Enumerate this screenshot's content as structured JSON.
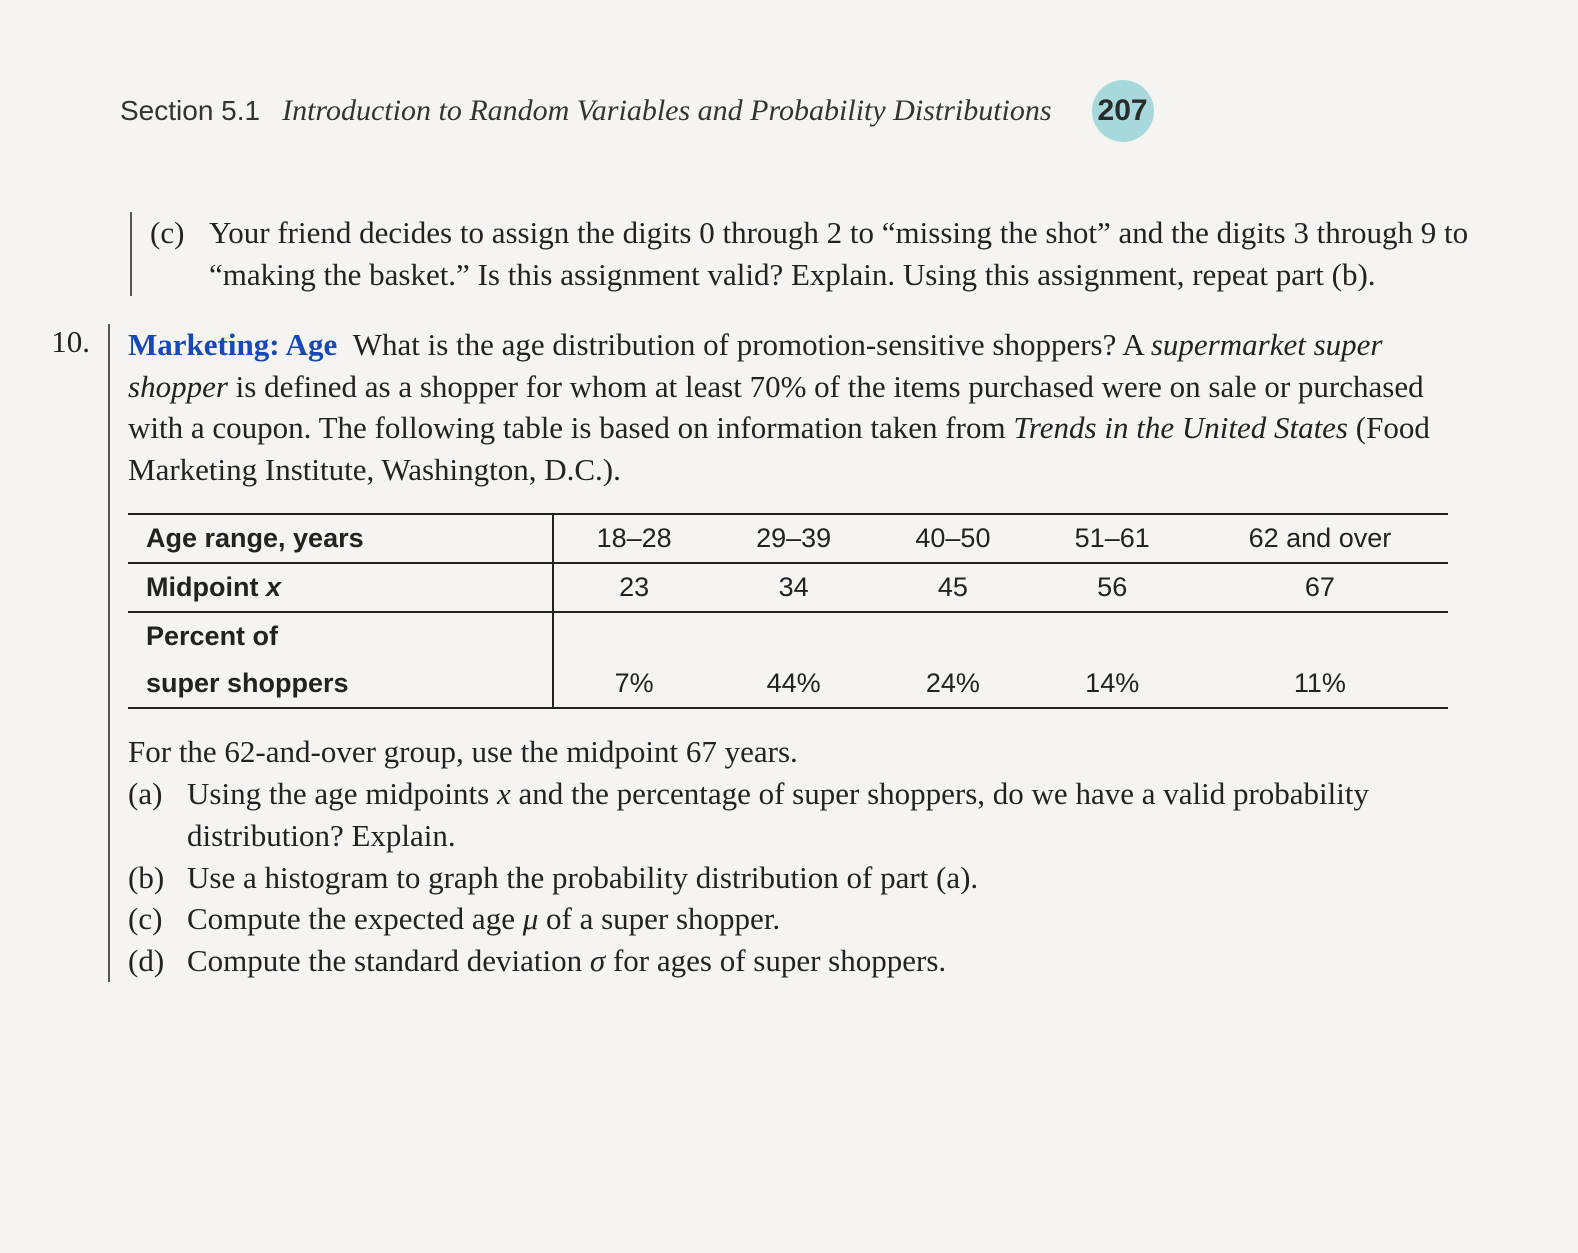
{
  "header": {
    "section_label": "Section 5.1",
    "section_title": "Introduction to Random Variables and Probability Distributions",
    "page_number": "207"
  },
  "problem_c": {
    "label": "(c)",
    "text": "Your friend decides to assign the digits 0 through 2 to “missing the shot” and the digits 3 through 9 to “making the basket.” Is this assignment valid? Explain. Using this assignment, repeat part (b)."
  },
  "problem_10": {
    "number": "10.",
    "topic": "Marketing: Age",
    "intro_pre": "What is the age distribution of promotion-sensitive shoppers? A ",
    "intro_ital": "supermarket super shopper",
    "intro_mid": " is defined as a shopper for whom at least 70% of the items purchased were on sale or purchased with a coupon. The following table is based on information taken from ",
    "intro_src": "Trends in the United States",
    "intro_post": " (Food Marketing Institute, Washington, D.C.).",
    "note": "For the 62-and-over group, use the midpoint 67 years.",
    "parts": {
      "a": {
        "label": "(a)",
        "text_pre": "Using the age midpoints ",
        "text_var": "x",
        "text_post": " and the percentage of super shoppers, do we have a valid probability distribution? Explain."
      },
      "b": {
        "label": "(b)",
        "text": "Use a histogram to graph the probability distribution of part (a)."
      },
      "c": {
        "label": "(c)",
        "text_pre": "Compute the expected age ",
        "text_sym": "μ",
        "text_post": " of a super shopper."
      },
      "d": {
        "label": "(d)",
        "text_pre": "Compute the standard deviation ",
        "text_sym": "σ",
        "text_post": " for ages of super shoppers."
      }
    }
  },
  "table": {
    "row_labels": {
      "age_range": "Age range, years",
      "midpoint_pre": "Midpoint ",
      "midpoint_var": "x",
      "percent_l1": "Percent of",
      "percent_l2": "super shoppers"
    },
    "columns": [
      "18–28",
      "29–39",
      "40–50",
      "51–61",
      "62 and over"
    ],
    "midpoints": [
      "23",
      "34",
      "45",
      "56",
      "67"
    ],
    "percents": [
      "7%",
      "44%",
      "24%",
      "14%",
      "11%"
    ]
  },
  "chart_data": {
    "type": "table",
    "title": "Age distribution of supermarket super shoppers",
    "categories": [
      "18–28",
      "29–39",
      "40–50",
      "51–61",
      "62 and over"
    ],
    "series": [
      {
        "name": "Midpoint x (years)",
        "values": [
          23,
          34,
          45,
          56,
          67
        ]
      },
      {
        "name": "Percent of super shoppers",
        "values": [
          7,
          44,
          24,
          14,
          11
        ]
      }
    ],
    "xlabel": "Age range, years",
    "ylabel": ""
  }
}
